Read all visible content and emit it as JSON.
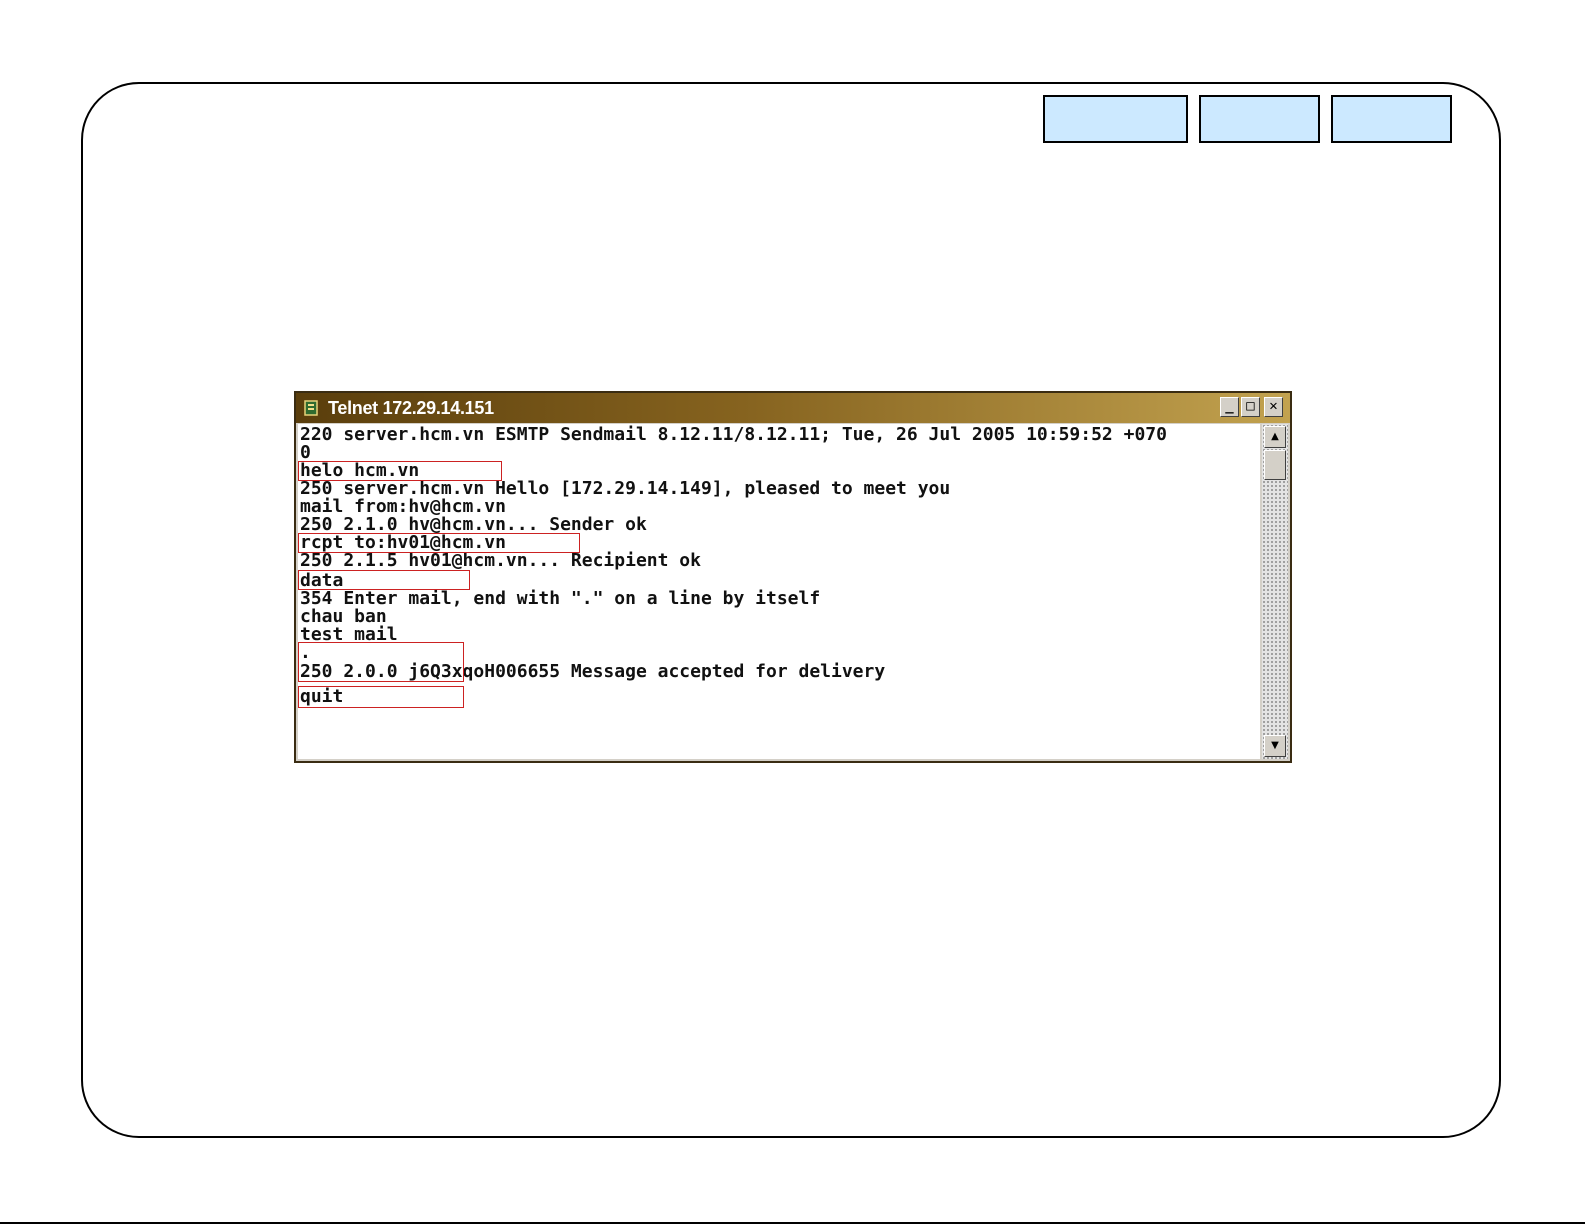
{
  "window": {
    "title": "Telnet 172.29.14.151",
    "icon": "telnet-icon",
    "controls": {
      "minimize": "_",
      "maximize": "□",
      "close": "✕"
    }
  },
  "console": {
    "lines": [
      "220 server.hcm.vn ESMTP Sendmail 8.12.11/8.12.11; Tue, 26 Jul 2005 10:59:52 +070",
      "0",
      "helo hcm.vn",
      "250 server.hcm.vn Hello [172.29.14.149], pleased to meet you",
      "mail from:hv@hcm.vn",
      "250 2.1.0 hv@hcm.vn... Sender ok",
      "rcpt to:hv01@hcm.vn",
      "250 2.1.5 hv01@hcm.vn... Recipient ok",
      "data",
      "354 Enter mail, end with \".\" on a line by itself",
      "chau ban",
      "test mail",
      ".",
      "250 2.0.0 j6Q3xqoH006655 Message accepted for delivery",
      "quit"
    ]
  },
  "colors": {
    "highlight": "#cc2222",
    "nav_fill": "#cce9ff",
    "titlebar_start": "#5a3e0c",
    "titlebar_end": "#c2a24f"
  }
}
